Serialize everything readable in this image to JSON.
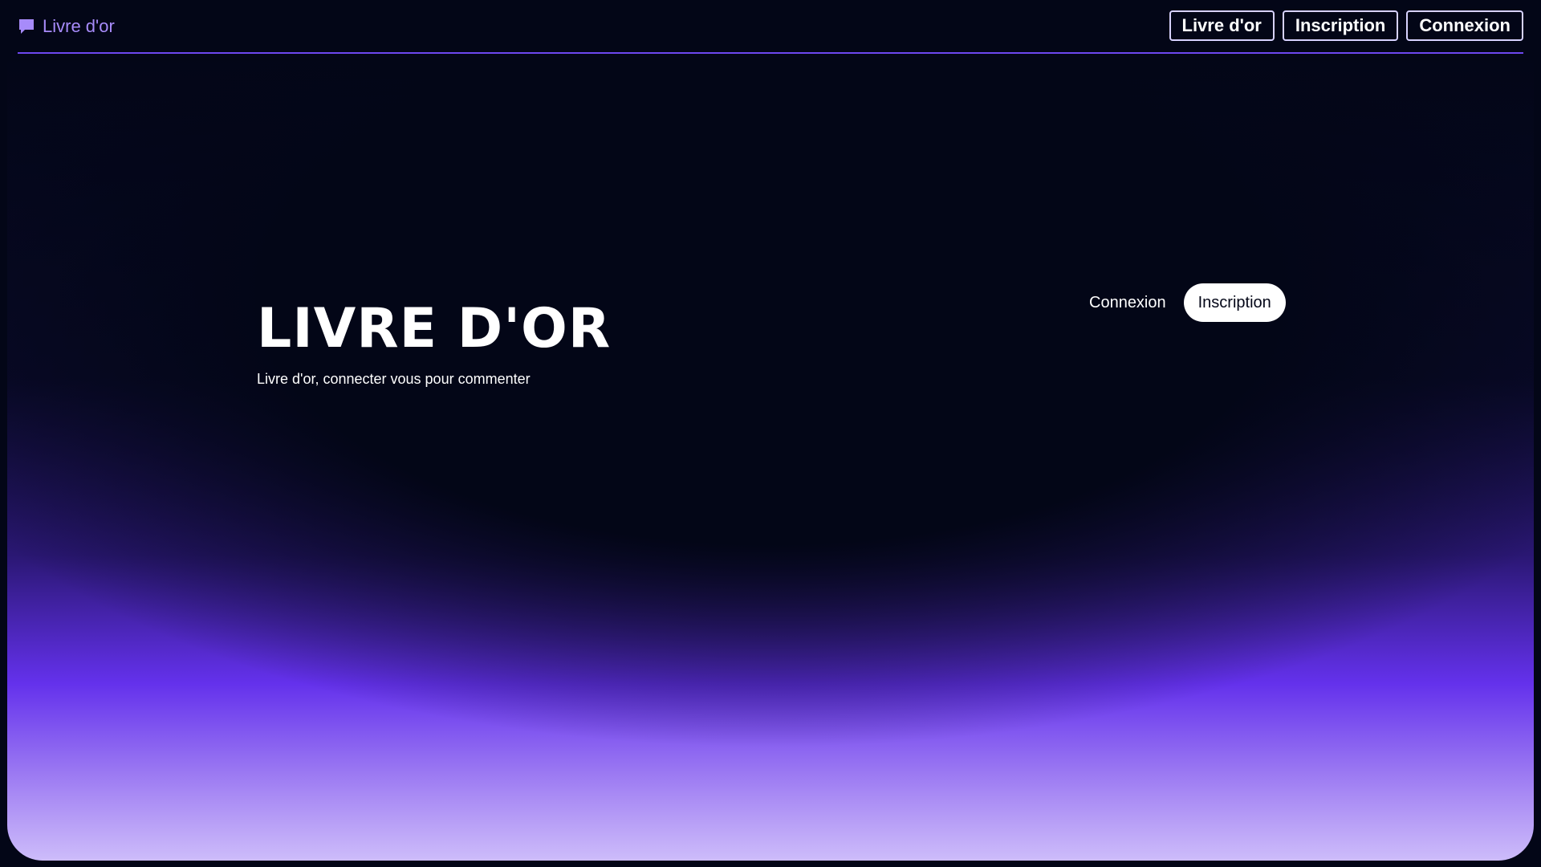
{
  "nav": {
    "brand_label": "Livre d'or",
    "brand_icon": "comment-icon",
    "buttons": [
      {
        "label": "Livre d'or"
      },
      {
        "label": "Inscription"
      },
      {
        "label": "Connexion"
      }
    ]
  },
  "hero": {
    "title": "LIVRE D'OR",
    "subtitle": "Livre d'or, connecter vous pour commenter",
    "login_label": "Connexion",
    "signup_label": "Inscription"
  },
  "colors": {
    "background": "#030617",
    "accent": "#6d47f0",
    "brand": "#a78bfa",
    "gradient_bottom": "#cdbcfa"
  }
}
